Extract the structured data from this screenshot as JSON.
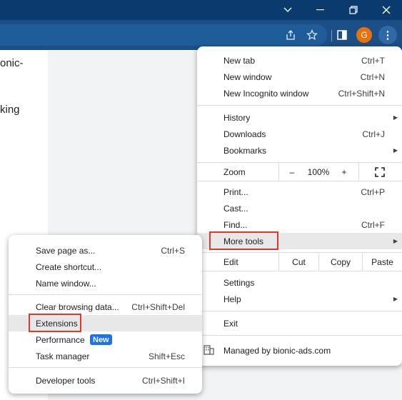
{
  "window": {
    "controls": {
      "tabs_icon": "chevron-down-icon",
      "minimize_icon": "minimize-icon",
      "restore_icon": "restore-icon",
      "close_icon": "close-icon"
    }
  },
  "toolbar": {
    "avatar_letter": "G",
    "icons": [
      "share-icon",
      "bookmark-star-icon",
      "side-panel-icon",
      "profile-avatar",
      "more-options-icon"
    ]
  },
  "page": {
    "line1": "onic-",
    "line2": "king"
  },
  "menu": {
    "new_tab": {
      "label": "New tab",
      "shortcut": "Ctrl+T"
    },
    "new_window": {
      "label": "New window",
      "shortcut": "Ctrl+N"
    },
    "new_incognito": {
      "label": "New Incognito window",
      "shortcut": "Ctrl+Shift+N"
    },
    "history": {
      "label": "History"
    },
    "downloads": {
      "label": "Downloads",
      "shortcut": "Ctrl+J"
    },
    "bookmarks": {
      "label": "Bookmarks"
    },
    "zoom": {
      "label": "Zoom",
      "minus": "–",
      "value": "100%",
      "plus": "+",
      "fullscreen_icon": "fullscreen-icon"
    },
    "print": {
      "label": "Print...",
      "shortcut": "Ctrl+P"
    },
    "cast": {
      "label": "Cast..."
    },
    "find": {
      "label": "Find...",
      "shortcut": "Ctrl+F"
    },
    "more_tools": {
      "label": "More tools"
    },
    "edit": {
      "label": "Edit",
      "cut": "Cut",
      "copy": "Copy",
      "paste": "Paste"
    },
    "settings": {
      "label": "Settings"
    },
    "help": {
      "label": "Help"
    },
    "exit": {
      "label": "Exit"
    },
    "managed": {
      "label": "Managed by bionic-ads.com",
      "icon": "building-icon"
    }
  },
  "submenu": {
    "save_page": {
      "label": "Save page as...",
      "shortcut": "Ctrl+S"
    },
    "create_shortcut": {
      "label": "Create shortcut..."
    },
    "name_window": {
      "label": "Name window..."
    },
    "clear_browsing": {
      "label": "Clear browsing data...",
      "shortcut": "Ctrl+Shift+Del"
    },
    "extensions": {
      "label": "Extensions"
    },
    "performance": {
      "label": "Performance",
      "badge": "New"
    },
    "task_manager": {
      "label": "Task manager",
      "shortcut": "Shift+Esc"
    },
    "developer_tools": {
      "label": "Developer tools",
      "shortcut": "Ctrl+Shift+I"
    }
  },
  "colors": {
    "titlebar": "#0b3a6e",
    "toolbar": "#1b4f85",
    "highlight_box": "#e0392b",
    "badge": "#1a73e8",
    "avatar": "#e8710a"
  }
}
